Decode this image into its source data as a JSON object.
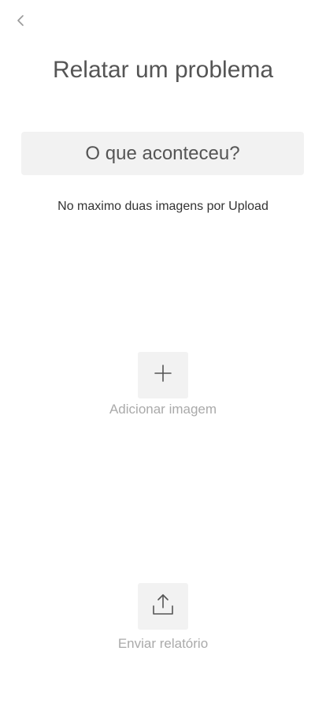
{
  "header": {
    "back_icon": "chevron-left-icon",
    "title": "Relatar um problema"
  },
  "form": {
    "question_label": "O que aconteceu?",
    "upload_hint": "No maximo duas imagens por Upload"
  },
  "actions": {
    "add_image": {
      "icon": "plus-icon",
      "label": "Adicionar imagem"
    },
    "send_report": {
      "icon": "upload-icon",
      "label": "Enviar relatório"
    }
  },
  "colors": {
    "text": "#555555",
    "muted": "#aaaaaa",
    "tile_background": "#f2f2f2"
  }
}
